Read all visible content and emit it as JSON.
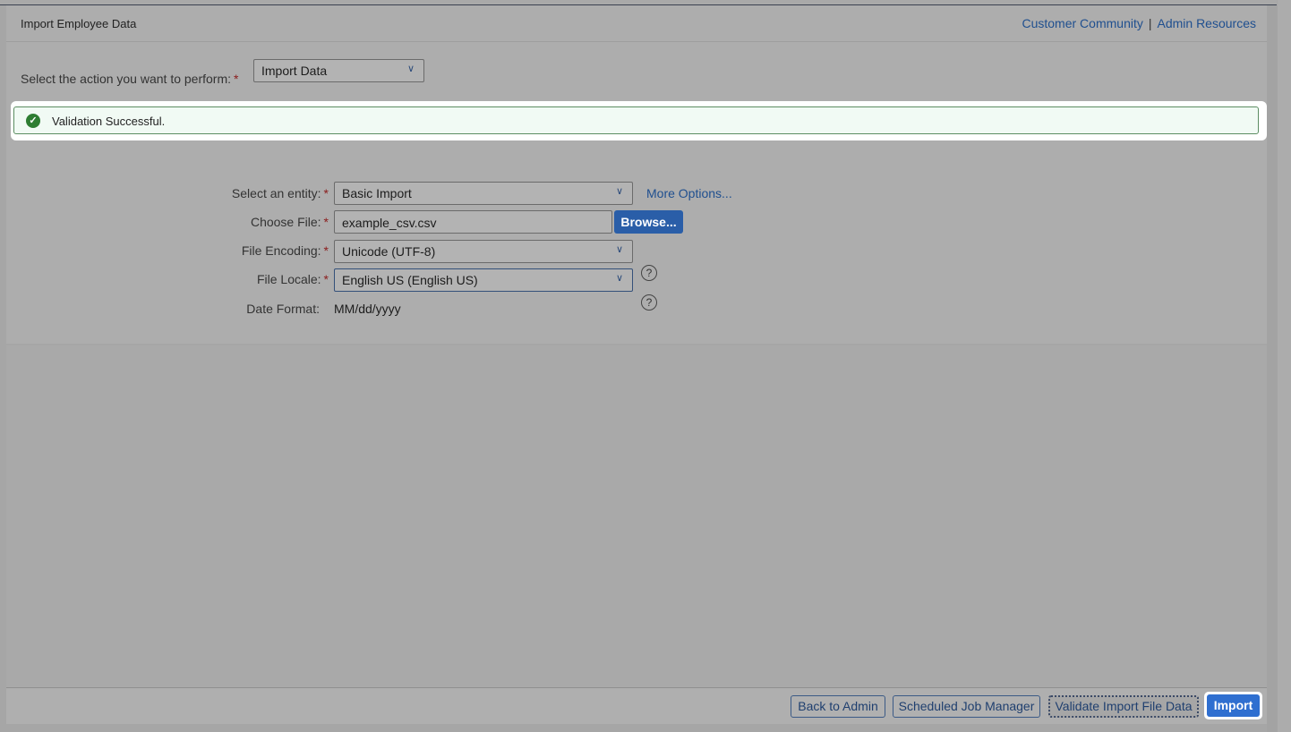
{
  "header": {
    "title": "Import Employee Data",
    "links": [
      "Customer Community",
      "Admin Resources"
    ],
    "separator": "|"
  },
  "action": {
    "label": "Select the action you want to perform:",
    "required_mark": "*",
    "value": "Import Data"
  },
  "message": {
    "type": "success",
    "text": "Validation Successful.",
    "icon": "check-circle-icon"
  },
  "form": {
    "entity": {
      "label": "Select an entity:",
      "required": "*",
      "value": "Basic Import",
      "more_options": "More Options..."
    },
    "file": {
      "label": "Choose File:",
      "required": "*",
      "value": "example_csv.csv",
      "browse": "Browse..."
    },
    "encoding": {
      "label": "File Encoding:",
      "required": "*",
      "value": "Unicode (UTF-8)"
    },
    "locale": {
      "label": "File Locale:",
      "required": "*",
      "value": "English US (English US)"
    },
    "date_format": {
      "label": "Date Format:",
      "value": "MM/dd/yyyy"
    },
    "help_glyph": "?",
    "chevron_glyph": "∨"
  },
  "footer": {
    "back": "Back to Admin",
    "scheduler": "Scheduled Job Manager",
    "validate": "Validate Import File Data",
    "import": "Import"
  },
  "colors": {
    "link": "#1f4f8f",
    "primary": "#2f6fd0",
    "success": "#2e7d32",
    "required": "#8b1c1c"
  }
}
